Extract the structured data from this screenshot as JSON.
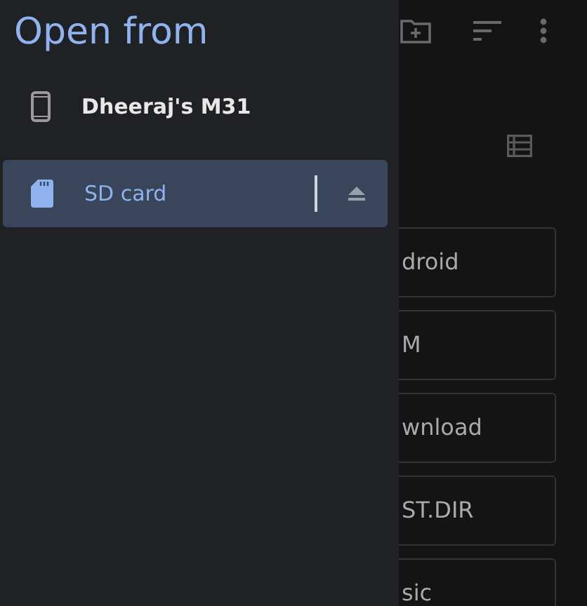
{
  "drawer": {
    "title": "Open from",
    "items": [
      {
        "label": "Dheeraj's M31",
        "kind": "phone",
        "selected": false,
        "ejectable": false
      },
      {
        "label": "SD card",
        "kind": "sdcard",
        "selected": true,
        "ejectable": true
      }
    ]
  },
  "folders": [
    {
      "name": "droid"
    },
    {
      "name": "M"
    },
    {
      "name": "wnload"
    },
    {
      "name": "ST.DIR"
    },
    {
      "name": "sic"
    }
  ]
}
